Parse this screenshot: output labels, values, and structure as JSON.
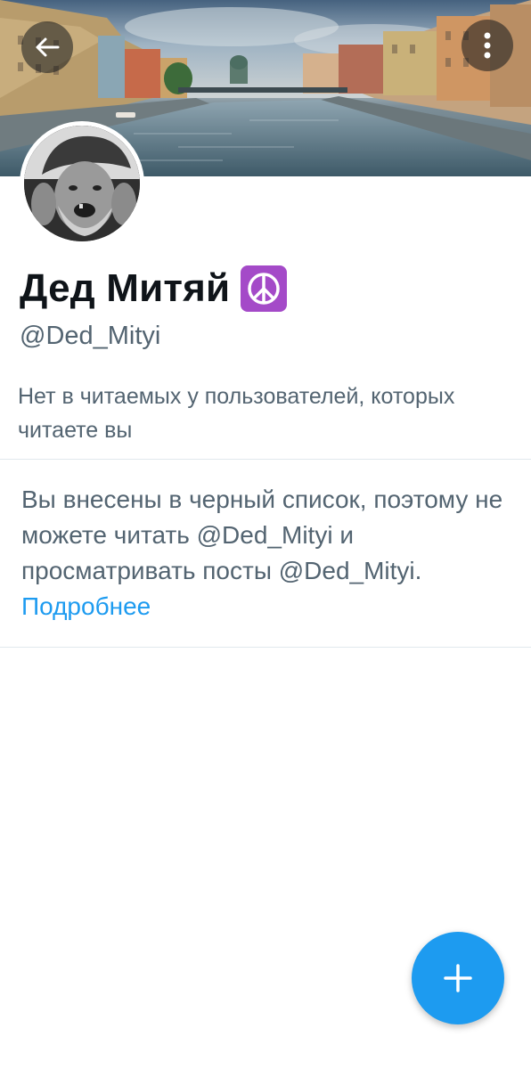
{
  "header": {
    "banner_image": "city-canal-banner",
    "back_icon": "arrow-left-icon",
    "more_icon": "more-vertical-icon"
  },
  "profile": {
    "display_name": "Дед Митяй",
    "name_emoji": "☮",
    "handle": "@Ded_Mityi",
    "follows_info": "Нет в читаемых у пользователей, которых читаете вы"
  },
  "blocked_notice": {
    "message": "Вы внесены в черный список, поэтому не можете читать @Ded_Mityi и просматривать посты @Ded_Mityi.",
    "learn_more": "Подробнее"
  },
  "fab": {
    "icon": "plus-icon"
  },
  "colors": {
    "accent": "#1d9bf0",
    "text_primary": "#0f1419",
    "text_secondary": "#536471",
    "divider": "#e1e8ed",
    "peace_badge": "#a44ac8"
  }
}
